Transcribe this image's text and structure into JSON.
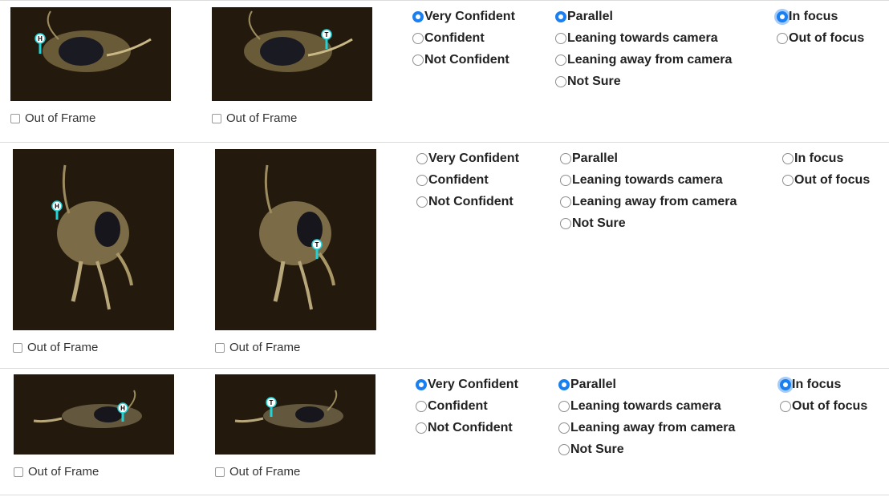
{
  "out_of_frame_label": "Out of Frame",
  "colors": {
    "accent": "#1a7ff0",
    "marker": "#22d3d6",
    "image_bg": "#1e160c"
  },
  "rows": [
    {
      "head_marker": "H",
      "tail_marker": "T",
      "confidence": {
        "options": [
          "Very Confident",
          "Confident",
          "Not Confident"
        ],
        "selected": 0
      },
      "orientation": {
        "options": [
          "Parallel",
          "Leaning towards camera",
          "Leaning away from camera",
          "Not Sure"
        ],
        "selected": 0
      },
      "focus": {
        "options": [
          "In focus",
          "Out of focus"
        ],
        "selected": 0
      }
    },
    {
      "head_marker": "H",
      "tail_marker": "T",
      "confidence": {
        "options": [
          "Very Confident",
          "Confident",
          "Not Confident"
        ],
        "selected": -1
      },
      "orientation": {
        "options": [
          "Parallel",
          "Leaning towards camera",
          "Leaning away from camera",
          "Not Sure"
        ],
        "selected": -1
      },
      "focus": {
        "options": [
          "In focus",
          "Out of focus"
        ],
        "selected": -1
      }
    },
    {
      "head_marker": "H",
      "tail_marker": "T",
      "confidence": {
        "options": [
          "Very Confident",
          "Confident",
          "Not Confident"
        ],
        "selected": 0
      },
      "orientation": {
        "options": [
          "Parallel",
          "Leaning towards camera",
          "Leaning away from camera",
          "Not Sure"
        ],
        "selected": 0
      },
      "focus": {
        "options": [
          "In focus",
          "Out of focus"
        ],
        "selected": 0
      }
    }
  ]
}
